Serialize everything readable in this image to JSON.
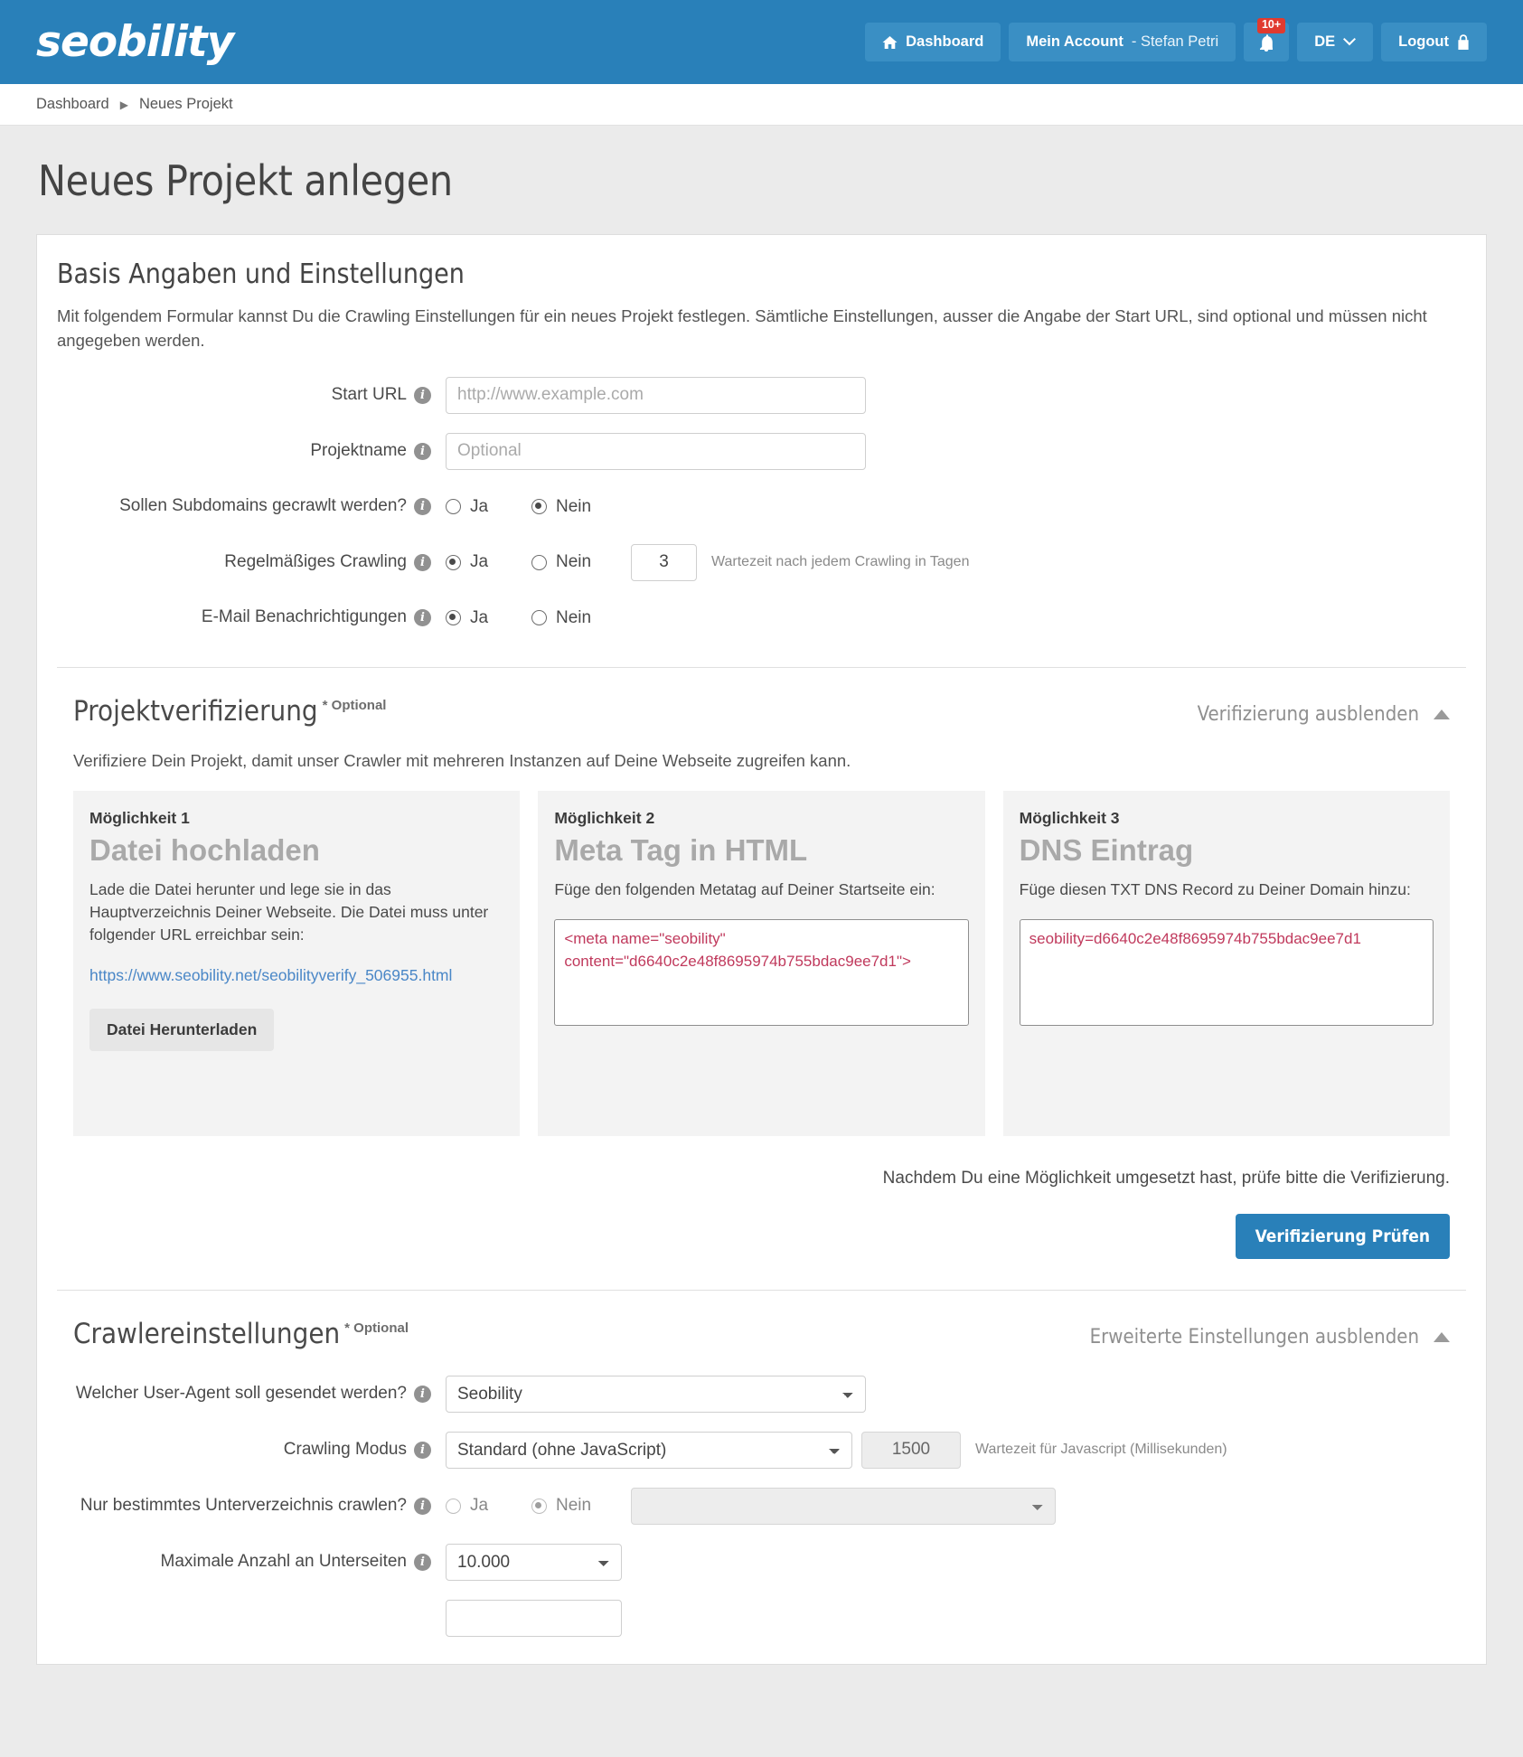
{
  "header": {
    "logo": "seobility",
    "nav": [
      {
        "name": "dashboard",
        "label": "Dashboard",
        "icon": "home-icon"
      },
      {
        "name": "account",
        "label_strong": "Mein Account",
        "label_light": "- Stefan Petri",
        "icon": null
      },
      {
        "name": "notifications",
        "label": "",
        "icon": "bell-icon",
        "badge": "10+"
      },
      {
        "name": "language",
        "label": "DE",
        "icon": "chevron-down-icon"
      },
      {
        "name": "logout",
        "label": "Logout",
        "icon": "lock-icon"
      }
    ],
    "colors": {
      "bar": "#2980b9",
      "button": "#3a8fc4",
      "badge": "#e03a2f"
    }
  },
  "breadcrumb": {
    "items": [
      "Dashboard",
      "Neues Projekt"
    ],
    "separator": "▶"
  },
  "page": {
    "title": "Neues Projekt anlegen"
  },
  "basis": {
    "title": "Basis Angaben und Einstellungen",
    "intro": "Mit folgendem Formular kannst Du die Crawling Einstellungen für ein neues Projekt festlegen. Sämtliche Einstellungen, ausser die Angabe der Start URL, sind optional und müssen nicht angegeben werden.",
    "start_url": {
      "label": "Start URL",
      "value": "",
      "placeholder": "http://www.example.com"
    },
    "project_name": {
      "label": "Projektname",
      "value": "",
      "placeholder": "Optional"
    },
    "subdomains": {
      "label": "Sollen Subdomains gecrawlt werden?",
      "yes": "Ja",
      "no": "Nein",
      "selected": "no"
    },
    "regular_crawling": {
      "label": "Regelmäßiges Crawling",
      "yes": "Ja",
      "no": "Nein",
      "selected": "yes",
      "days_value": "3",
      "hint": "Wartezeit nach jedem Crawling in Tagen"
    },
    "email_notifications": {
      "label": "E-Mail Benachrichtigungen",
      "yes": "Ja",
      "no": "Nein",
      "selected": "yes"
    }
  },
  "verification": {
    "title": "Projektverifizierung",
    "optional_tag": "* Optional",
    "toggle_label": "Verifizierung ausblenden",
    "description": "Verifiziere Dein Projekt, damit unser Crawler mit mehreren Instanzen auf Deine Webseite zugreifen kann.",
    "cards": [
      {
        "kicker": "Möglichkeit 1",
        "heading": "Datei hochladen",
        "text": "Lade die Datei herunter und lege sie in das Hauptverzeichnis Deiner Webseite. Die Datei muss unter folgender URL erreichbar sein:",
        "link": "https://www.seobility.net/seobilityverify_506955.html",
        "button": "Datei Herunterladen"
      },
      {
        "kicker": "Möglichkeit 2",
        "heading": "Meta Tag in HTML",
        "text": "Füge den folgenden Metatag auf Deiner Startseite ein:",
        "code": "<meta name=\"seobility\" content=\"d6640c2e48f8695974b755bdac9ee7d1\">"
      },
      {
        "kicker": "Möglichkeit 3",
        "heading": "DNS Eintrag",
        "text": "Füge diesen TXT DNS Record zu Deiner Domain hinzu:",
        "code": "seobility=d6640c2e48f8695974b755bdac9ee7d1"
      }
    ],
    "footer_note": "Nachdem Du eine Möglichkeit umgesetzt hast, prüfe bitte die Verifizierung.",
    "check_button": "Verifizierung Prüfen"
  },
  "crawler": {
    "title": "Crawlereinstellungen",
    "optional_tag": "* Optional",
    "toggle_label": "Erweiterte Einstellungen ausblenden",
    "user_agent": {
      "label": "Welcher User-Agent soll gesendet werden?",
      "value": "Seobility"
    },
    "crawling_mode": {
      "label": "Crawling Modus",
      "value": "Standard (ohne JavaScript)",
      "js_wait_value": "1500",
      "hint": "Wartezeit für Javascript (Millisekunden)"
    },
    "subdirectory": {
      "label": "Nur bestimmtes Unterverzeichnis crawlen?",
      "yes": "Ja",
      "no": "Nein",
      "selected": "no",
      "select_value": ""
    },
    "max_pages": {
      "label": "Maximale Anzahl an Unterseiten",
      "value": "10.000"
    }
  }
}
